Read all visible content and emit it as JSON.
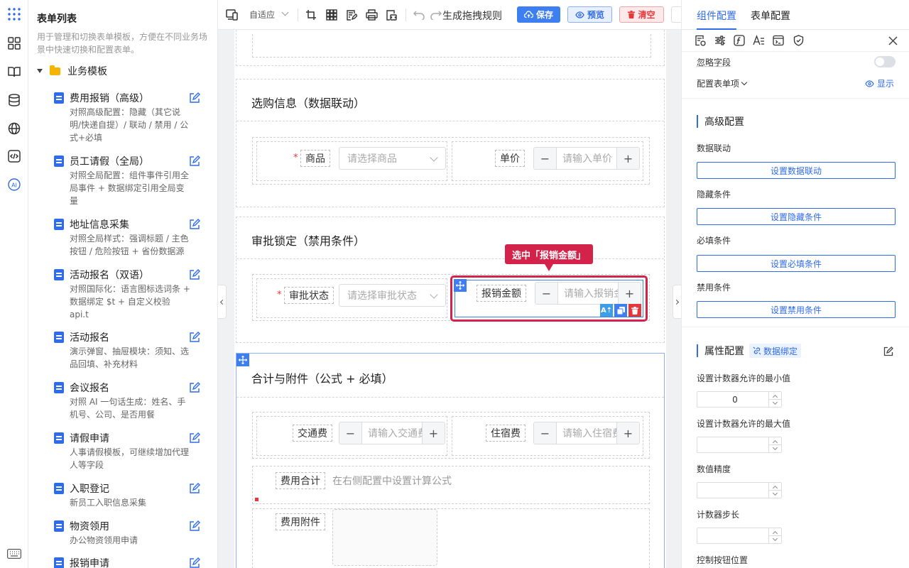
{
  "sidebar": {
    "title": "表单列表",
    "description": "用于管理和切换表单模板，方便在不同业务场景中快速切换和配置表单。",
    "group": "业务模板",
    "items": [
      {
        "name": "费用报销（高级）",
        "desc": "对照高级配置：隐藏（其它说明/快递自提）/ 联动 / 禁用 / 公式+必填"
      },
      {
        "name": "员工请假（全局）",
        "desc": "对照全局配置：组件事件引用全局事件 + 数据绑定引用全局变量"
      },
      {
        "name": "地址信息采集",
        "desc": "对照全局样式：强调标题 / 主色按钮 / 危险按钮 + 省份数据源"
      },
      {
        "name": "活动报名（双语）",
        "desc": "对照国际化：语言图标选词条 + 数据绑定 $t + 自定义校验 api.t"
      },
      {
        "name": "活动报名",
        "desc": "演示弹窗、抽屉模块：须知、选品回填、补充材料"
      },
      {
        "name": "会议报名",
        "desc": "对照 AI 一句话生成：姓名、手机号、公司、是否用餐"
      },
      {
        "name": "请假申请",
        "desc": "人事请假模板，可继续增加代理人等字段"
      },
      {
        "name": "入职登记",
        "desc": "新员工入职信息采集"
      },
      {
        "name": "物资领用",
        "desc": "办公物资领用申请"
      },
      {
        "name": "报销申请",
        "desc": ""
      }
    ]
  },
  "toolbar": {
    "fit_label": "自适应",
    "gen_rules": "生成拖拽规则",
    "save": "保存",
    "preview": "预览",
    "clear": "清空"
  },
  "canvas": {
    "sections": [
      {
        "title": "选购信息（数据联动）",
        "fields": [
          {
            "label": "商品",
            "required": "*",
            "placeholder": "请选择商品"
          },
          {
            "label": "单价",
            "placeholder": "请输入单价"
          }
        ]
      },
      {
        "title": "审批锁定（禁用条件）",
        "fields": [
          {
            "label": "审批状态",
            "required": "*",
            "placeholder": "请选择审批状态"
          },
          {
            "label": "报销金额",
            "placeholder": "请输入报销金额"
          }
        ]
      },
      {
        "title": "合计与附件（公式 + 必填）",
        "fields": [
          {
            "label": "交通费",
            "placeholder": "请输入交通费"
          },
          {
            "label": "住宿费",
            "placeholder": "请输入住宿费"
          },
          {
            "label": "费用合计",
            "placeholder": "在右侧配置中设置计算公式"
          },
          {
            "label": "费用附件"
          }
        ]
      }
    ],
    "selected_tooltip": "选中「报销金额」"
  },
  "panel": {
    "tabs": [
      "组件配置",
      "表单配置"
    ],
    "ignore_field": "忽略字段",
    "config_items": "配置表单项",
    "show": "显示",
    "advanced": {
      "title": "高级配置",
      "rows": [
        {
          "label": "数据联动",
          "button": "设置数据联动"
        },
        {
          "label": "隐藏条件",
          "button": "设置隐藏条件"
        },
        {
          "label": "必填条件",
          "button": "设置必填条件"
        },
        {
          "label": "禁用条件",
          "button": "设置禁用条件"
        }
      ]
    },
    "props": {
      "title": "属性配置",
      "binding": "数据绑定",
      "min_label": "设置计数器允许的最小值",
      "min_value": "0",
      "max_label": "设置计数器允许的最大值",
      "precision_label": "数值精度",
      "step_label": "计数器步长",
      "btn_pos_label": "控制按钮位置"
    }
  },
  "colors": {
    "primary": "#2f6bed",
    "danger": "#e4393c",
    "selected": "#d4234a"
  }
}
